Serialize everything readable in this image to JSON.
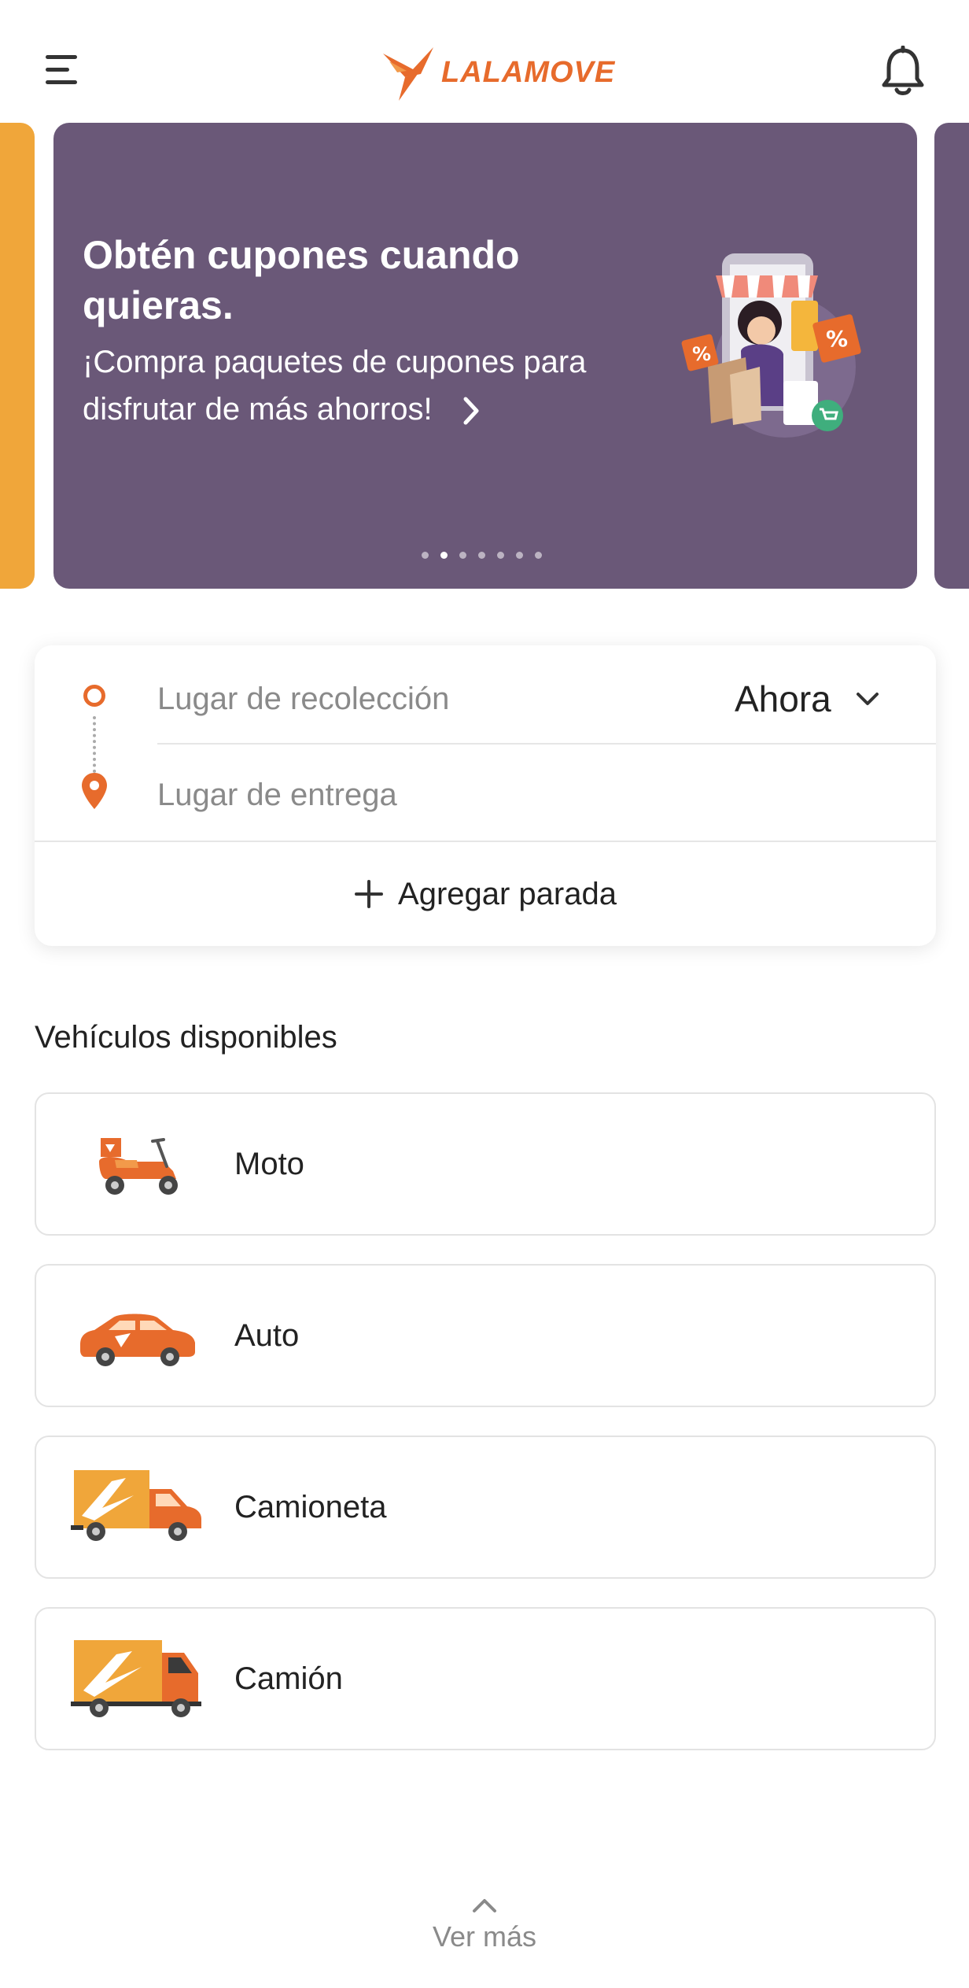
{
  "header": {
    "logo_text": "LALAMOVE",
    "brand_color": "#e76b2c",
    "menu_icon": "hamburger-menu-icon",
    "notification_icon": "bell-icon"
  },
  "banner": {
    "title": "Obtén cupones cuando quieras.",
    "subtitle": "¡Compra paquetes de cupones para disfrutar de más ahorros!",
    "background_color": "#6a5878",
    "dots_total": 7,
    "active_dot": 2
  },
  "route": {
    "pickup_placeholder": "Lugar de recolección",
    "dropoff_placeholder": "Lugar de entrega",
    "time_value": "Ahora",
    "add_stop_label": "Agregar parada"
  },
  "vehicles": {
    "section_title": "Vehículos disponibles",
    "items": [
      {
        "label": "Moto",
        "icon": "motorcycle-icon"
      },
      {
        "label": "Auto",
        "icon": "car-icon"
      },
      {
        "label": "Camioneta",
        "icon": "van-icon"
      },
      {
        "label": "Camión",
        "icon": "truck-icon"
      }
    ]
  },
  "footer": {
    "see_more_label": "Ver más"
  }
}
